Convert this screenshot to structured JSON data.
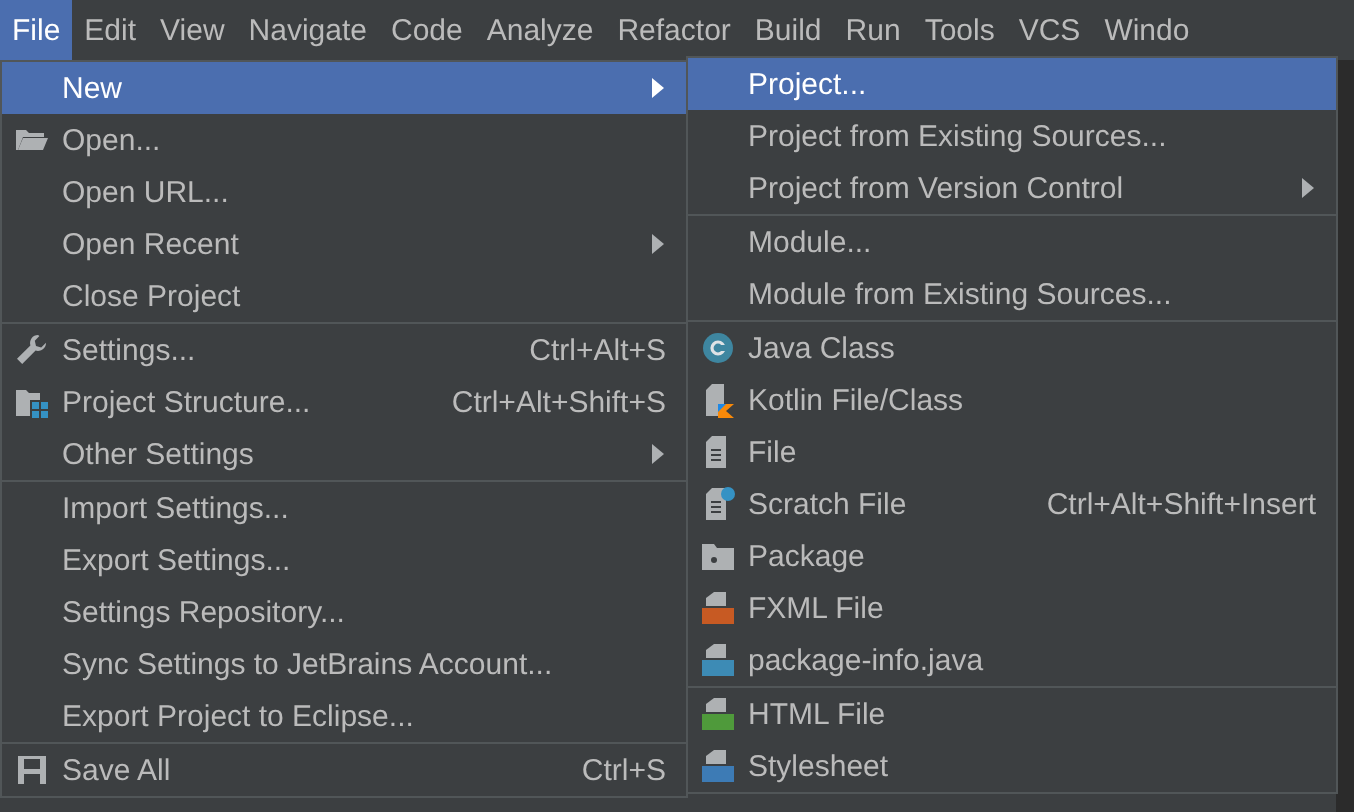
{
  "menubar": [
    {
      "label": "File",
      "selected": true
    },
    {
      "label": "Edit",
      "selected": false
    },
    {
      "label": "View",
      "selected": false
    },
    {
      "label": "Navigate",
      "selected": false
    },
    {
      "label": "Code",
      "selected": false
    },
    {
      "label": "Analyze",
      "selected": false
    },
    {
      "label": "Refactor",
      "selected": false
    },
    {
      "label": "Build",
      "selected": false
    },
    {
      "label": "Run",
      "selected": false
    },
    {
      "label": "Tools",
      "selected": false
    },
    {
      "label": "VCS",
      "selected": false
    },
    {
      "label": "Windo",
      "selected": false
    }
  ],
  "file_menu": {
    "groups": [
      [
        {
          "label": "New",
          "selected": true,
          "submenu": true
        },
        {
          "label": "Open...",
          "kind": "folder",
          "selected": false
        },
        {
          "label": "Open URL...",
          "selected": false
        },
        {
          "label": "Open Recent",
          "selected": false,
          "submenu": true
        },
        {
          "label": "Close Project",
          "selected": false
        }
      ],
      [
        {
          "label": "Settings...",
          "kind": "wrench",
          "shortcut": "Ctrl+Alt+S",
          "selected": false
        },
        {
          "label": "Project Structure...",
          "kind": "structure",
          "shortcut": "Ctrl+Alt+Shift+S",
          "selected": false
        },
        {
          "label": "Other Settings",
          "selected": false,
          "submenu": true
        }
      ],
      [
        {
          "label": "Import Settings...",
          "selected": false
        },
        {
          "label": "Export Settings...",
          "selected": false
        },
        {
          "label": "Settings Repository...",
          "selected": false
        },
        {
          "label": "Sync Settings to JetBrains Account...",
          "selected": false
        },
        {
          "label": "Export Project to Eclipse...",
          "selected": false
        }
      ],
      [
        {
          "label": "Save All",
          "kind": "save",
          "shortcut": "Ctrl+S",
          "selected": false
        }
      ]
    ]
  },
  "new_submenu": {
    "groups": [
      [
        {
          "label": "Project...",
          "selected": true
        },
        {
          "label": "Project from Existing Sources...",
          "selected": false
        },
        {
          "label": "Project from Version Control",
          "selected": false,
          "submenu": true
        }
      ],
      [
        {
          "label": "Module...",
          "selected": false
        },
        {
          "label": "Module from Existing Sources...",
          "selected": false
        }
      ],
      [
        {
          "label": "Java Class",
          "kind": "java-class",
          "selected": false
        },
        {
          "label": "Kotlin File/Class",
          "kind": "kotlin",
          "selected": false
        },
        {
          "label": "File",
          "kind": "file",
          "selected": false
        },
        {
          "label": "Scratch File",
          "kind": "scratch",
          "shortcut": "Ctrl+Alt+Shift+Insert",
          "selected": false
        },
        {
          "label": "Package",
          "kind": "package",
          "selected": false
        },
        {
          "label": "FXML File",
          "kind": "fxml",
          "selected": false
        },
        {
          "label": "package-info.java",
          "kind": "java-file",
          "selected": false
        }
      ],
      [
        {
          "label": "HTML File",
          "kind": "html",
          "selected": false
        },
        {
          "label": "Stylesheet",
          "kind": "css",
          "selected": false
        }
      ]
    ]
  }
}
